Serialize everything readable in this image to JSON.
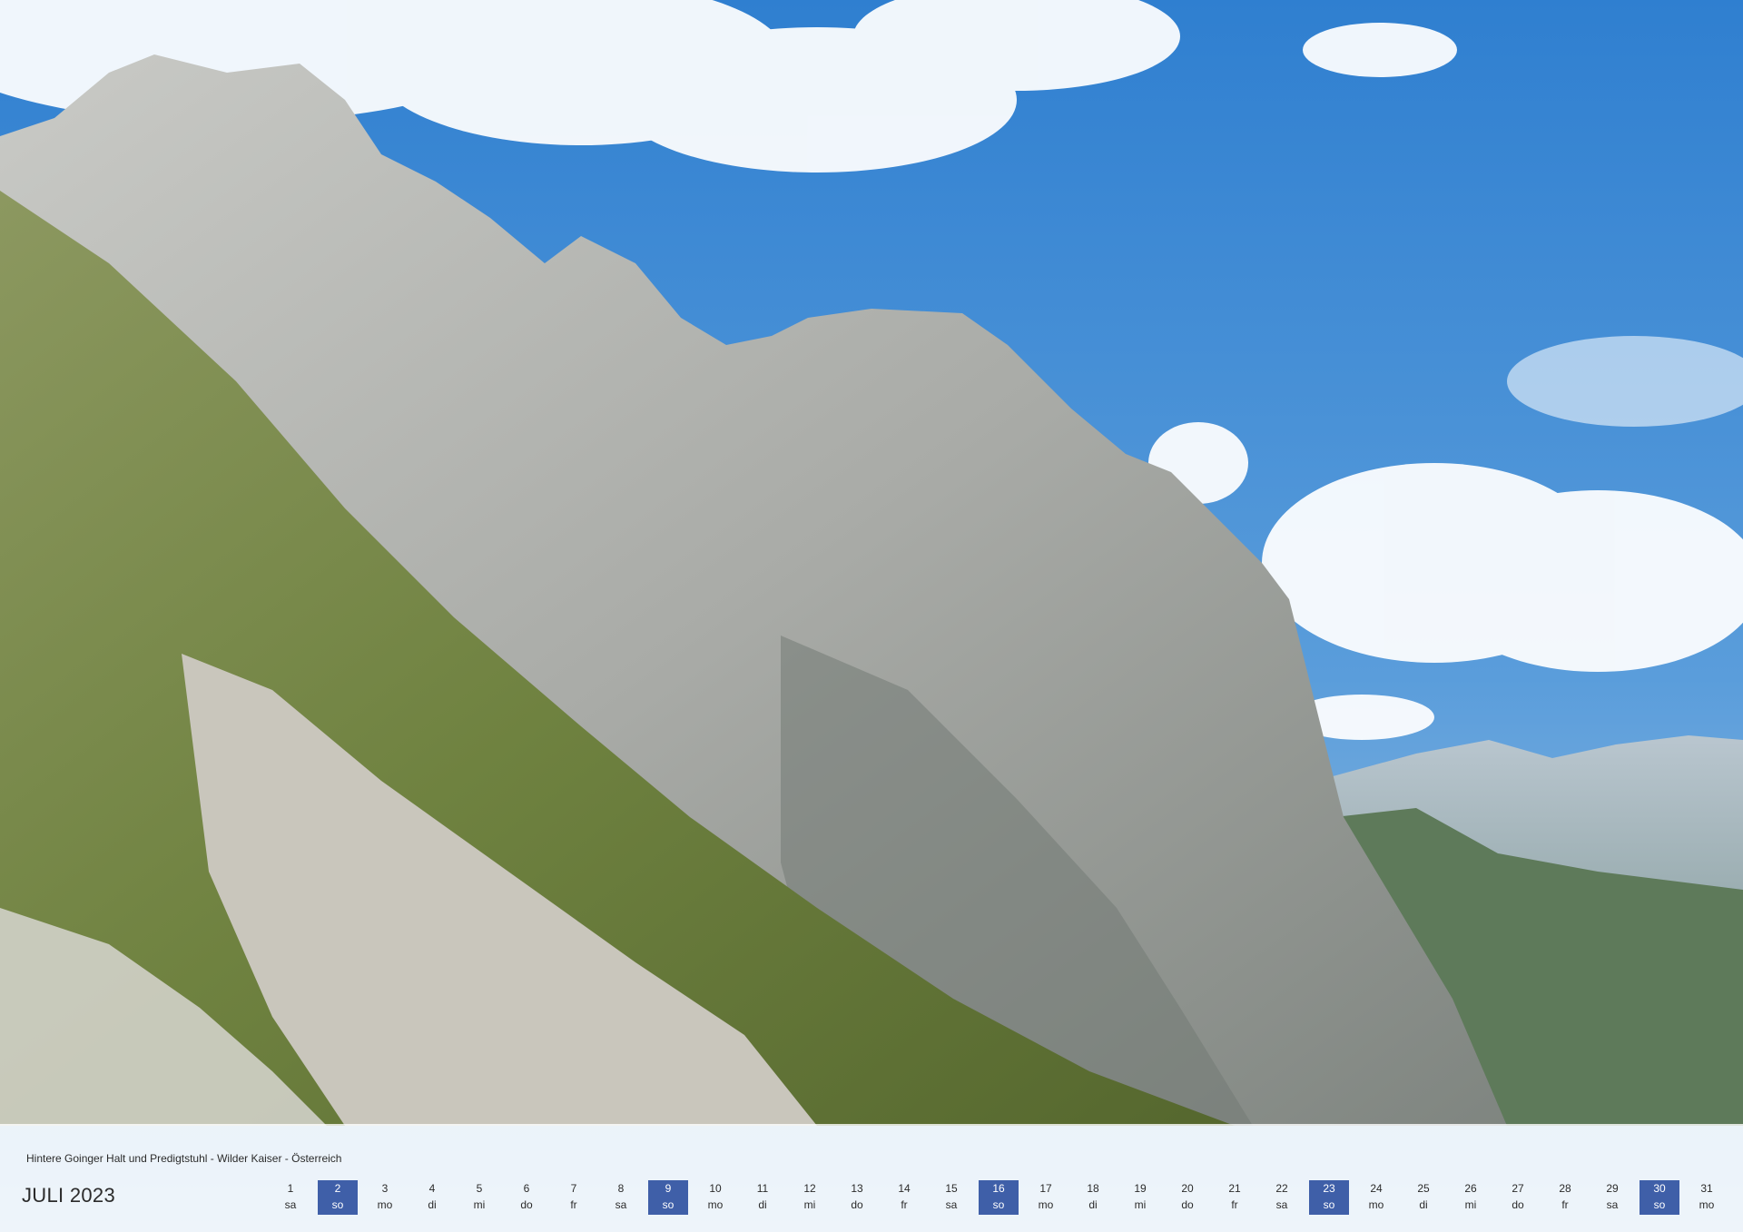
{
  "caption": "Hintere Goinger Halt und Predigtstuhl - Wilder Kaiser - Österreich",
  "month_title": "JULI 2023",
  "colors": {
    "sunday_highlight": "#3f5fa8",
    "sky": "#4f93d3",
    "rock": "#b5b7b3",
    "grass": "#748a3a"
  },
  "days": [
    {
      "n": "1",
      "d": "sa"
    },
    {
      "n": "2",
      "d": "so",
      "sun": true
    },
    {
      "n": "3",
      "d": "mo"
    },
    {
      "n": "4",
      "d": "di"
    },
    {
      "n": "5",
      "d": "mi"
    },
    {
      "n": "6",
      "d": "do"
    },
    {
      "n": "7",
      "d": "fr"
    },
    {
      "n": "8",
      "d": "sa"
    },
    {
      "n": "9",
      "d": "so",
      "sun": true
    },
    {
      "n": "10",
      "d": "mo"
    },
    {
      "n": "11",
      "d": "di"
    },
    {
      "n": "12",
      "d": "mi"
    },
    {
      "n": "13",
      "d": "do"
    },
    {
      "n": "14",
      "d": "fr"
    },
    {
      "n": "15",
      "d": "sa"
    },
    {
      "n": "16",
      "d": "so",
      "sun": true
    },
    {
      "n": "17",
      "d": "mo"
    },
    {
      "n": "18",
      "d": "di"
    },
    {
      "n": "19",
      "d": "mi"
    },
    {
      "n": "20",
      "d": "do"
    },
    {
      "n": "21",
      "d": "fr"
    },
    {
      "n": "22",
      "d": "sa"
    },
    {
      "n": "23",
      "d": "so",
      "sun": true
    },
    {
      "n": "24",
      "d": "mo"
    },
    {
      "n": "25",
      "d": "di"
    },
    {
      "n": "26",
      "d": "mi"
    },
    {
      "n": "27",
      "d": "do"
    },
    {
      "n": "28",
      "d": "fr"
    },
    {
      "n": "29",
      "d": "sa"
    },
    {
      "n": "30",
      "d": "so",
      "sun": true
    },
    {
      "n": "31",
      "d": "mo"
    }
  ]
}
